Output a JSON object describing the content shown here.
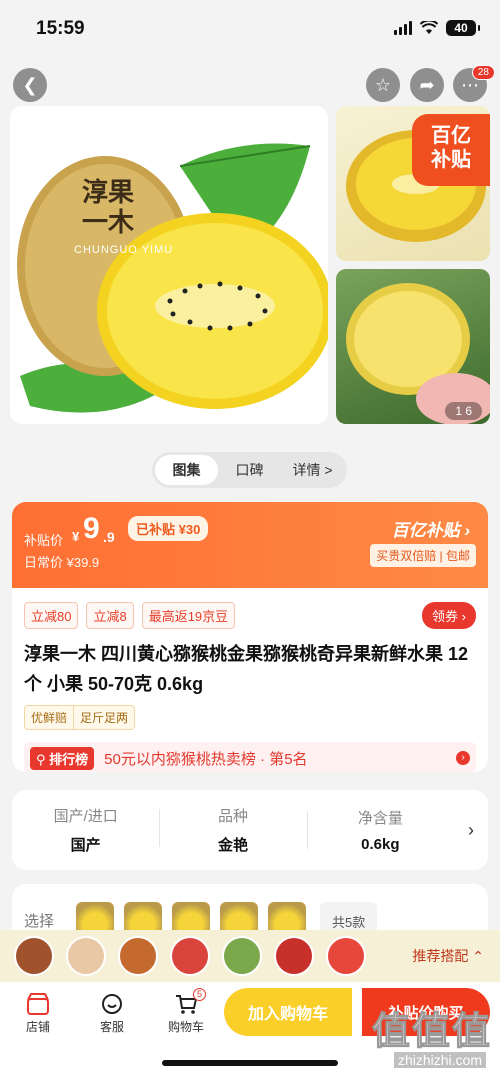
{
  "status": {
    "time": "15:59",
    "battery": "40"
  },
  "top_nav": {
    "more_badge": "28"
  },
  "gallery": {
    "brand_mark": "淳果一木",
    "brand_en": "CHUNGUO YIMU",
    "subsidy_tag_l1": "百亿",
    "subsidy_tag_l2": "补贴",
    "counter": "1 6"
  },
  "tabs": [
    {
      "label": "图集"
    },
    {
      "label": "口碑"
    },
    {
      "label": "详情 >"
    }
  ],
  "price": {
    "label": "补贴价",
    "yen": "¥",
    "integer": "9",
    "decimal": ".9",
    "daily": "日常价 ¥39.9",
    "subsidy_tag": "已补贴 ¥30",
    "brand": "百亿补贴 ›",
    "brand_sub": "买贵双倍赔 | 包邮",
    "colors": {
      "accent": "#ff6f34",
      "red": "#e8372c"
    }
  },
  "coupons": [
    "立减80",
    "立减8",
    "最高返19京豆"
  ],
  "coupon_button": "领券 ›",
  "product_title": "淳果一木 四川黄心猕猴桃金果猕猴桃奇异果新鲜水果 12个 小果 50-70克 0.6kg",
  "features": [
    "优鲜赔",
    "足斤足两"
  ],
  "rank": {
    "badge": "排行榜",
    "text": "50元以内猕猴桃热卖榜 · 第5名"
  },
  "specs": [
    {
      "k": "国产/进口",
      "v": "国产"
    },
    {
      "k": "品种",
      "v": "金艳"
    },
    {
      "k": "净含量",
      "v": "0.6kg"
    }
  ],
  "options": {
    "label": "选择",
    "count": "共5款"
  },
  "recommend": {
    "label": "推荐搭配 ⌃"
  },
  "bottom": {
    "shop": "店铺",
    "service": "客服",
    "cart": "购物车",
    "cart_badge": "5",
    "add_cart": "加入购物车",
    "buy": "补贴价购买"
  },
  "watermark": {
    "text": "值值值",
    "url": "zhizhizhi.com"
  }
}
